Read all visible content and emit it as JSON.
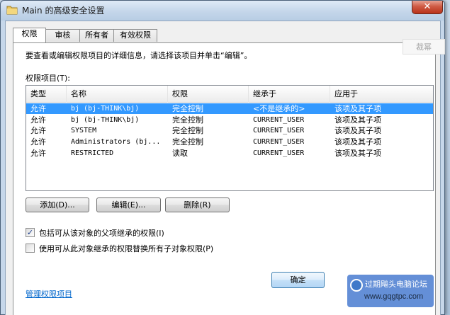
{
  "window": {
    "title": "Main 的高级安全设置",
    "close_label": "✕"
  },
  "tabs": [
    {
      "label": "权限",
      "active": true
    },
    {
      "label": "审核",
      "active": false
    },
    {
      "label": "所有者",
      "active": false
    },
    {
      "label": "有效权限",
      "active": false
    }
  ],
  "permissions": {
    "description": "要查看或编辑权限项目的详细信息，请选择该项目并单击“编辑”。",
    "list_label": "权限项目(T):",
    "columns": [
      "类型",
      "名称",
      "权限",
      "继承于",
      "应用于"
    ],
    "rows": [
      {
        "type": "允许",
        "name": "bj (bj-THINK\\bj)",
        "permission": "完全控制",
        "inherited_from": "<不是继承的>",
        "applies_to": "该项及其子项",
        "selected": true
      },
      {
        "type": "允许",
        "name": "bj (bj-THINK\\bj)",
        "permission": "完全控制",
        "inherited_from": "CURRENT_USER",
        "applies_to": "该项及其子项",
        "selected": false
      },
      {
        "type": "允许",
        "name": "SYSTEM",
        "permission": "完全控制",
        "inherited_from": "CURRENT_USER",
        "applies_to": "该项及其子项",
        "selected": false
      },
      {
        "type": "允许",
        "name": "Administrators (bj...",
        "permission": "完全控制",
        "inherited_from": "CURRENT_USER",
        "applies_to": "该项及其子项",
        "selected": false
      },
      {
        "type": "允许",
        "name": "RESTRICTED",
        "permission": "读取",
        "inherited_from": "CURRENT_USER",
        "applies_to": "该项及其子项",
        "selected": false
      }
    ],
    "buttons": {
      "add": "添加(D)...",
      "edit": "编辑(E)...",
      "remove": "删除(R)"
    },
    "checkboxes": [
      {
        "label": "包括可从该对象的父项继承的权限(I)",
        "checked": true
      },
      {
        "label": "使用可从此对象继承的权限替换所有子对象权限(P)",
        "checked": false
      }
    ],
    "manage_link": "管理权限项目"
  },
  "footer": {
    "ok_label": "确定"
  },
  "background": {
    "ghost_button": "裁幂"
  },
  "watermark": {
    "line1": "过期飚头电脑论坛",
    "line2": "www.gqgtpc.com"
  },
  "colors": {
    "selection": "#3399ff",
    "link": "#0066cc",
    "close_button": "#c7452c"
  },
  "icons": {
    "title": "folder-icon",
    "close": "close-icon",
    "checkbox_checked": "checkmark-icon"
  }
}
